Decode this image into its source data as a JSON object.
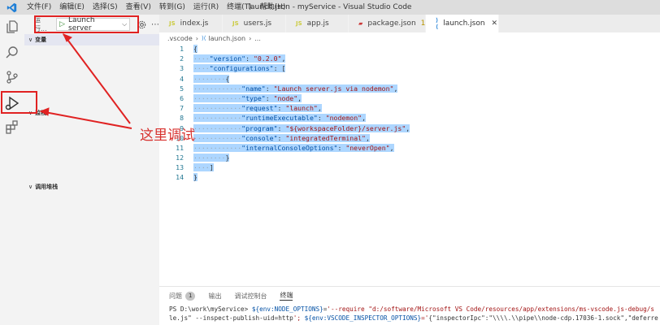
{
  "window": {
    "title": "launch.json - myService - Visual Studio Code"
  },
  "menu": [
    "文件(F)",
    "编辑(E)",
    "选择(S)",
    "查看(V)",
    "转到(G)",
    "运行(R)",
    "终端(T)",
    "帮助(H)"
  ],
  "activity": [
    "explorer-icon",
    "search-icon",
    "source-control-icon",
    "run-debug-icon",
    "extensions-icon"
  ],
  "run": {
    "label": "运行...",
    "config": "Launch server",
    "more": "⋯"
  },
  "sections": {
    "variables": "变量",
    "watch": "监视",
    "callstack": "调用堆栈"
  },
  "tabs": [
    {
      "icon": "JS",
      "label": "index.js"
    },
    {
      "icon": "JS",
      "label": "users.js"
    },
    {
      "icon": "JS",
      "label": "app.js"
    },
    {
      "icon": "pkg",
      "label": "package.json",
      "badge": "1"
    },
    {
      "icon": "vscode",
      "label": "launch.json"
    }
  ],
  "breadcrumb": {
    "folder": ".vscode",
    "file": "launch.json",
    "more": "..."
  },
  "code_lines": [
    {
      "n": "1",
      "text": "{"
    },
    {
      "n": "2",
      "text": "····\"version\": \"0.2.0\","
    },
    {
      "n": "3",
      "text": "····\"configurations\": ["
    },
    {
      "n": "4",
      "text": "········{"
    },
    {
      "n": "5",
      "text": "············\"name\": \"Launch server.js via nodemon\","
    },
    {
      "n": "6",
      "text": "············\"type\": \"node\","
    },
    {
      "n": "7",
      "text": "············\"request\": \"launch\","
    },
    {
      "n": "8",
      "text": "············\"runtimeExecutable\": \"nodemon\","
    },
    {
      "n": "9",
      "text": "············\"program\": \"${workspaceFolder}/server.js\","
    },
    {
      "n": "10",
      "text": "············\"console\": \"integratedTerminal\","
    },
    {
      "n": "11",
      "text": "············\"internalConsoleOptions\": \"neverOpen\","
    },
    {
      "n": "12",
      "text": "········}"
    },
    {
      "n": "13",
      "text": "····]"
    },
    {
      "n": "14",
      "text": "}"
    }
  ],
  "annotation": "这里调试",
  "panel": {
    "tabs": [
      "问题",
      "输出",
      "调试控制台",
      "终端"
    ],
    "problems_count": "1",
    "terminal": {
      "line1": "PS D:\\work\\myService> ${env:NODE_OPTIONS}='--require \"d:/software/Microsoft VS Code/resources/app/extensions/ms-vscode.js-debug/s",
      "line2": "le.js\" --inspect-publish-uid=http'; ${env:VSCODE_INSPECTOR_OPTIONS}='{\"inspectorIpc\":\"\\\\\\\\.\\\\pipe\\\\node-cdp.17036-1.sock\",\"deferre"
    }
  },
  "colors": {
    "annotation": "#e02222",
    "accent": "#007acc"
  }
}
